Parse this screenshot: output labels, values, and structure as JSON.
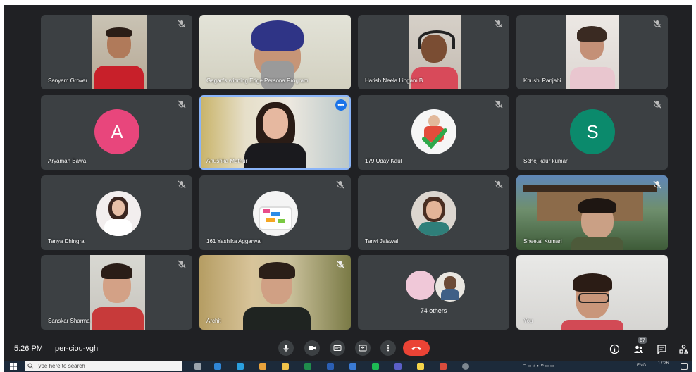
{
  "meeting": {
    "time": "5:26 PM",
    "separator": "|",
    "code": "per-ciou-vgh",
    "participant_count": "67"
  },
  "participants": [
    {
      "name": "Sanyam Grover"
    },
    {
      "name": "Gagan's winning Edge Persona Program"
    },
    {
      "name": "Harish Neela Lingam B"
    },
    {
      "name": "Khushi Panjabi"
    },
    {
      "name": "Aryaman Bawa",
      "initial": "A",
      "color": "#e8467c"
    },
    {
      "name": "Anushka Mathur"
    },
    {
      "name": "179 Uday Kaul"
    },
    {
      "name": "Sehej kaur kumar",
      "initial": "S",
      "color": "#0b8a6c"
    },
    {
      "name": "Tanya Dhingra"
    },
    {
      "name": "161 Yashika Aggarwal"
    },
    {
      "name": "Tanvi Jaiswal"
    },
    {
      "name": "Sheetal Kumari"
    },
    {
      "name": "Sanskar Sharma"
    },
    {
      "name": "Archit"
    },
    {
      "name": "74 others"
    },
    {
      "name": "You"
    }
  ],
  "controls": {
    "mic": "mic-icon",
    "camera": "camera-icon",
    "captions": "captions-icon",
    "present": "present-icon",
    "more": "more-options-icon",
    "hangup": "hangup-icon"
  },
  "taskbar": {
    "search_placeholder": "Type here to search",
    "lang": "ENG",
    "clock": "17:26"
  }
}
